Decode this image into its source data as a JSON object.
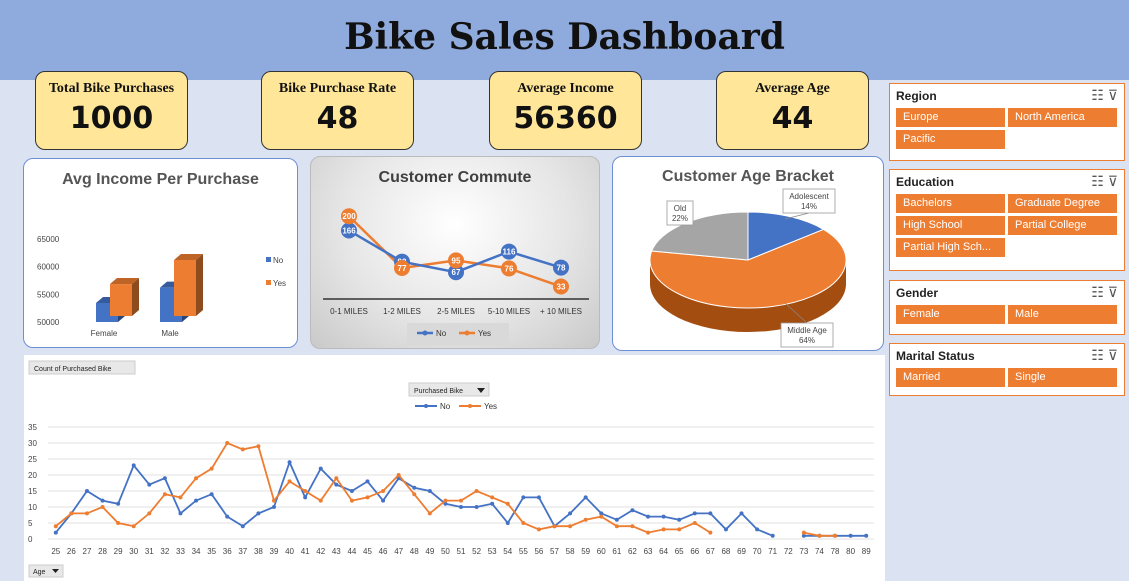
{
  "dashboard": {
    "title": "Bike Sales Dashboard"
  },
  "kpis": [
    {
      "label": "Total Bike Purchases",
      "value": "1000"
    },
    {
      "label": "Bike Purchase Rate",
      "value": "48"
    },
    {
      "label": "Average Income",
      "value": "56360"
    },
    {
      "label": "Average Age",
      "value": "44"
    }
  ],
  "colors": {
    "no": "#4472c4",
    "yes": "#ed7d31",
    "old": "#a5a5a5",
    "kpi_bg": "#ffe699",
    "header": "#8faadc"
  },
  "income_chart": {
    "title": "Avg Income Per Purchase",
    "chart_data": {
      "type": "bar",
      "categories": [
        "Female",
        "Male"
      ],
      "series": [
        {
          "name": "No",
          "values": [
            53440,
            56208
          ]
        },
        {
          "name": "Yes",
          "values": [
            55774,
            60124
          ]
        }
      ],
      "ylim": [
        50000,
        65000
      ],
      "yticks": [
        "50000",
        "55000",
        "60000",
        "65000"
      ],
      "legend": "right"
    }
  },
  "commute_chart": {
    "title": "Customer Commute",
    "chart_data": {
      "type": "line",
      "categories": [
        "0-1 MILES",
        "1-2 MILES",
        "2-5 MILES",
        "5-10 MILES",
        "+ 10 MILES"
      ],
      "series": [
        {
          "name": "No",
          "values": [
            166,
            92,
            67,
            116,
            78
          ]
        },
        {
          "name": "Yes",
          "values": [
            200,
            77,
            95,
            76,
            33
          ]
        }
      ],
      "legend": "bottom"
    }
  },
  "age_chart": {
    "title": "Customer Age Bracket",
    "chart_data": {
      "type": "pie",
      "slices": [
        {
          "name": "Adolescent",
          "value": 14,
          "label": "14%"
        },
        {
          "name": "Middle Age",
          "value": 64,
          "label": "64%"
        },
        {
          "name": "Old",
          "value": 22,
          "label": "22%"
        }
      ]
    }
  },
  "age_line": {
    "field_button": "Count of Purchased Bike",
    "filter_button": "Purchased Bike",
    "axis_button": "Age",
    "chart_data": {
      "type": "line",
      "x": [
        25,
        26,
        27,
        28,
        29,
        30,
        31,
        32,
        33,
        34,
        35,
        36,
        37,
        38,
        39,
        40,
        41,
        42,
        43,
        44,
        45,
        46,
        47,
        48,
        49,
        50,
        51,
        52,
        53,
        54,
        55,
        56,
        57,
        58,
        59,
        60,
        61,
        62,
        63,
        64,
        65,
        66,
        67,
        68,
        69,
        70,
        71,
        72,
        73,
        74,
        78,
        80,
        89
      ],
      "xlabels": [
        "25",
        "26",
        "27",
        "28",
        "29",
        "30",
        "31",
        "32",
        "33",
        "34",
        "35",
        "36",
        "37",
        "38",
        "39",
        "40",
        "41",
        "42",
        "43",
        "44",
        "45",
        "46",
        "47",
        "48",
        "49",
        "50",
        "51",
        "52",
        "53",
        "54",
        "55",
        "56",
        "57",
        "58",
        "59",
        "60",
        "61",
        "62",
        "63",
        "64",
        "65",
        "66",
        "67",
        "68",
        "69",
        "70",
        "71",
        "72",
        "73",
        "74",
        "78",
        "80",
        "89"
      ],
      "series": [
        {
          "name": "No",
          "values": [
            2,
            8,
            15,
            12,
            11,
            23,
            17,
            19,
            8,
            12,
            14,
            7,
            4,
            8,
            10,
            24,
            13,
            22,
            17,
            15,
            18,
            12,
            19,
            16,
            15,
            11,
            10,
            10,
            11,
            5,
            13,
            13,
            4,
            8,
            13,
            8,
            6,
            9,
            7,
            7,
            6,
            8,
            8,
            3,
            8,
            3,
            1,
            null,
            1,
            1,
            1,
            1,
            1
          ]
        },
        {
          "name": "Yes",
          "values": [
            4,
            8,
            8,
            10,
            5,
            4,
            8,
            14,
            13,
            19,
            22,
            30,
            28,
            29,
            12,
            18,
            15,
            12,
            19,
            12,
            13,
            15,
            20,
            14,
            8,
            12,
            12,
            15,
            13,
            11,
            5,
            3,
            4,
            4,
            6,
            7,
            4,
            4,
            2,
            3,
            3,
            5,
            2,
            null,
            null,
            null,
            null,
            null,
            2,
            1,
            1,
            null,
            null
          ]
        }
      ],
      "ylim": [
        0,
        35
      ],
      "yticks": [
        "0",
        "5",
        "10",
        "15",
        "20",
        "25",
        "30",
        "35"
      ],
      "legend": "top"
    }
  },
  "slicers": [
    {
      "title": "Region",
      "items": [
        "Europe",
        "North America",
        "Pacific"
      ]
    },
    {
      "title": "Education",
      "items": [
        "Bachelors",
        "Graduate Degree",
        "High School",
        "Partial College",
        "Partial High Sch..."
      ]
    },
    {
      "title": "Gender",
      "items": [
        "Female",
        "Male"
      ]
    },
    {
      "title": "Marital Status",
      "items": [
        "Married",
        "Single"
      ]
    }
  ]
}
